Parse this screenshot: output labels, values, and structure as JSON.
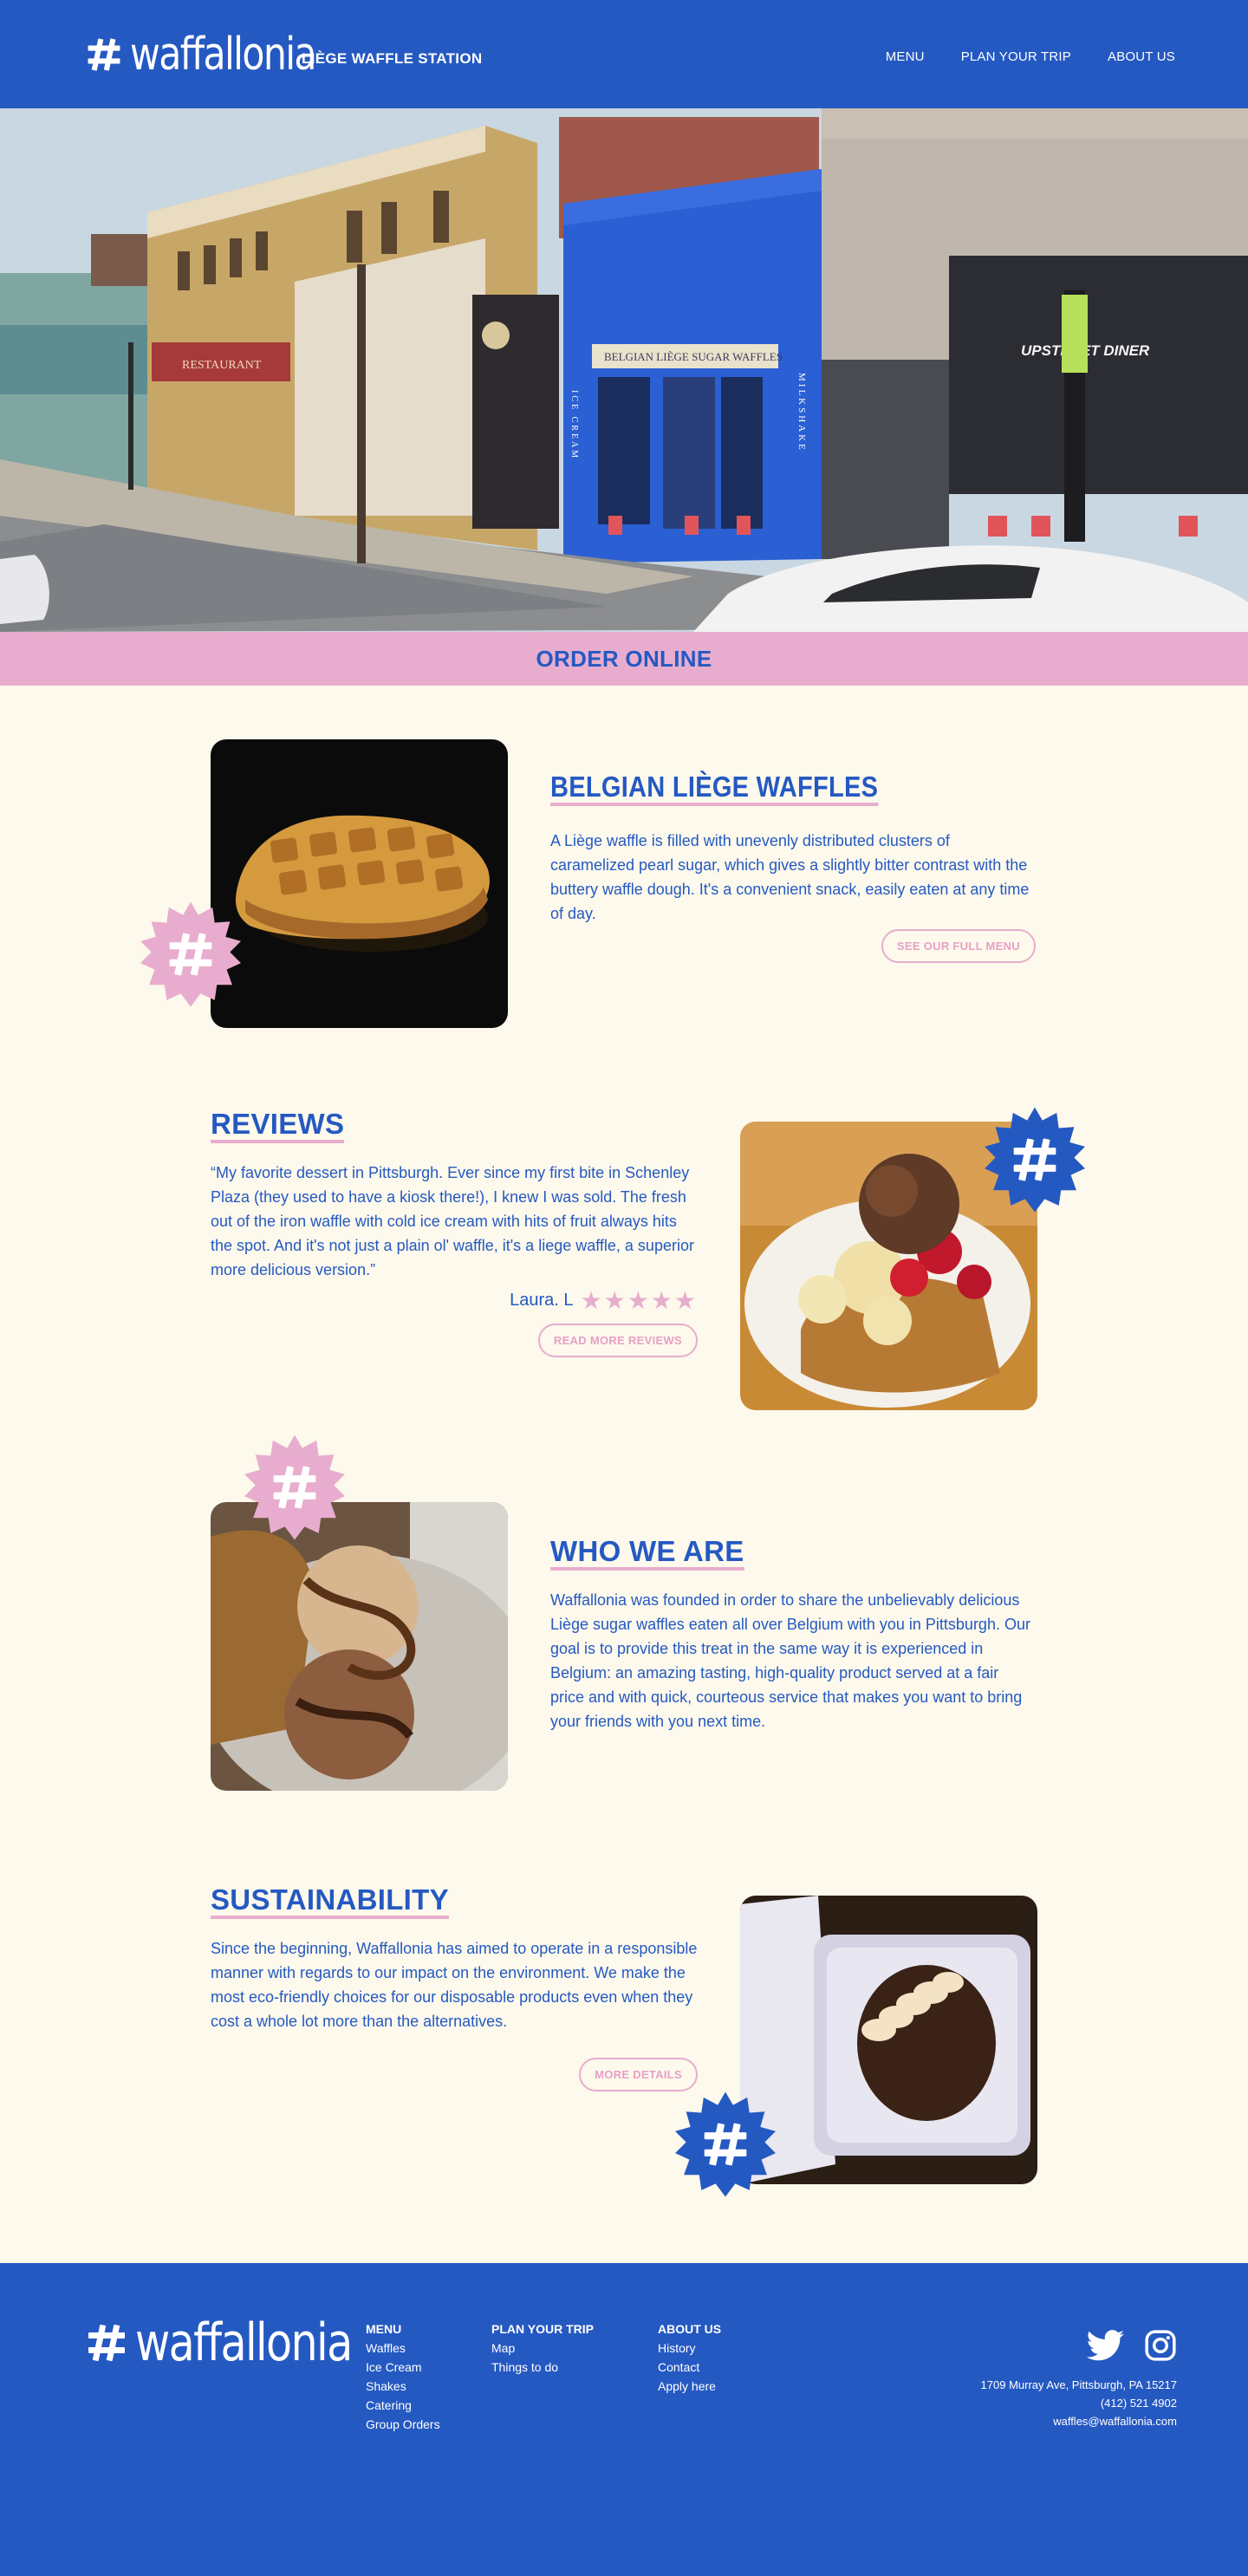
{
  "header": {
    "brand": "waffallonia",
    "tagline": "LIÈGE WAFFLE STATION",
    "nav": [
      "MENU",
      "PLAN YOUR TRIP",
      "ABOUT US"
    ]
  },
  "hero": {
    "storefront_sign": "BELGIAN LIÈGE SUGAR WAFFLES",
    "side_sign": "MILKSHAKE",
    "side_sign_left": "ICE CREAM",
    "diner_sign": "UPSTREET DINER"
  },
  "order_bar": {
    "label": "ORDER ONLINE"
  },
  "sections": {
    "waffles": {
      "title": "BELGIAN LIÈGE WAFFLES",
      "body": "A Liège waffle is filled with unevenly distributed clusters of caramelized pearl sugar, which gives a slightly bitter contrast with the buttery waffle dough. It's a convenient snack, easily eaten at any time of day.",
      "button": "SEE OUR FULL MENU"
    },
    "reviews": {
      "title": "REVIEWS",
      "quote": "“My favorite dessert in Pittsburgh. Ever since my first bite in Schenley Plaza (they used to have a kiosk there!), I knew I was sold. The fresh out of the iron waffle with cold ice cream with hits of fruit always hits the spot. And it's not just a plain ol' waffle, it's a liege waffle, a superior more delicious version.”",
      "reviewer": "Laura. L",
      "rating": 5,
      "stars": "★★★★★",
      "button": "READ MORE REVIEWS"
    },
    "about": {
      "title": "WHO WE ARE",
      "body": "Waffallonia was founded in order to share the unbelievably delicious Liège sugar waffles eaten all over Belgium with you in Pittsburgh. Our goal is to provide this treat in the same way it is experienced in Belgium: an amazing tasting, high-quality product served at a fair price and with quick, courteous service that makes you want to bring your friends with you next time."
    },
    "sustainability": {
      "title": "SUSTAINABILITY",
      "body": "Since the beginning, Waffallonia has aimed to operate in a responsible manner with regards to our impact on the environment. We make the most eco-friendly choices for our disposable products even when they cost a whole lot more than the alternatives.",
      "button": "MORE DETAILS"
    }
  },
  "footer": {
    "brand": "waffallonia",
    "columns": [
      {
        "heading": "MENU",
        "links": [
          "Waffles",
          "Ice Cream",
          "Shakes",
          "Catering",
          "Group Orders"
        ]
      },
      {
        "heading": "PLAN YOUR TRIP",
        "links": [
          "Map",
          "Things to do"
        ]
      },
      {
        "heading": "ABOUT US",
        "links": [
          "History",
          "Contact",
          "Apply here"
        ]
      }
    ],
    "address": "1709 Murray Ave, Pittsburgh, PA 15217",
    "phone": "(412) 521 4902",
    "email": "waffles@waffallonia.com",
    "social_icons": [
      "twitter-icon",
      "instagram-icon"
    ]
  },
  "colors": {
    "brand_blue": "#2559c2",
    "pink": "#e8adce",
    "cream": "#fdf9ec"
  }
}
